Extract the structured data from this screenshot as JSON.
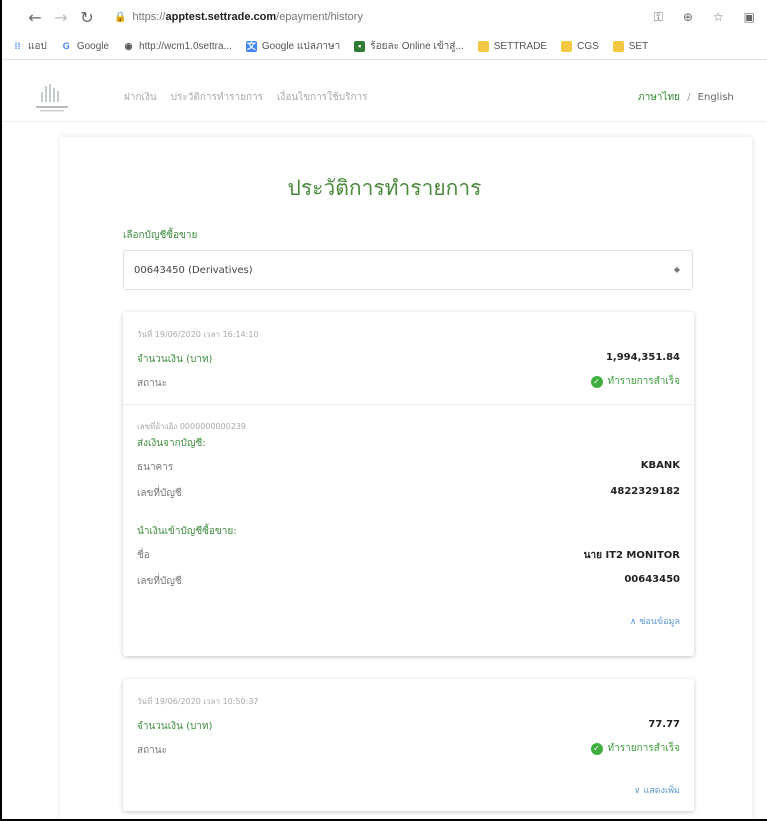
{
  "browser": {
    "url_prefix": "https://",
    "url_host": "apptest.settrade.com",
    "url_path": "/epayment/history",
    "bookmarks": [
      {
        "label": "แอป",
        "icon": "apps-grid-icon",
        "color": "#4a8af4"
      },
      {
        "label": "Google",
        "icon": "google-icon",
        "color": "#4285f4"
      },
      {
        "label": "http://wcm1.0settra...",
        "icon": "globe-icon",
        "color": "#555555"
      },
      {
        "label": "Google แปลภาษา",
        "icon": "translate-icon",
        "color": "#4285f4"
      },
      {
        "label": "ร้อยละ Online เข้าสู่...",
        "icon": "app-icon",
        "color": "#2e7d32"
      },
      {
        "label": "SETTRADE",
        "icon": "folder-icon",
        "color": "#f4c842"
      },
      {
        "label": "CGS",
        "icon": "folder-icon",
        "color": "#f4c842"
      },
      {
        "label": "SET",
        "icon": "folder-icon",
        "color": "#f4c842"
      }
    ]
  },
  "site": {
    "nav": [
      "ฝากเงิน",
      "ประวัติการทำรายการ",
      "เงื่อนไขการใช้บริการ"
    ],
    "lang_active": "ภาษาไทย",
    "lang_sep": "/",
    "lang_other": "English"
  },
  "page": {
    "title": "ประวัติการทำรายการ",
    "account_label": "เลือกบัญชีซื้อขาย",
    "account_value": "00643450 (Derivatives)"
  },
  "transactions": [
    {
      "datetime": "วันที่ 19/06/2020 เวลา 16:14:10",
      "amount_label": "จำนวนเงิน (บาท)",
      "amount": "1,994,351.84",
      "status_label": "สถานะ",
      "status": "ทำรายการสำเร็จ",
      "ref": "เลขที่อ้างอิง 0000000000239",
      "from_heading": "ส่งเงินจากบัญชี:",
      "bank_label": "ธนาคาร",
      "bank": "KBANK",
      "from_acct_label": "เลขที่บัญชี",
      "from_acct": "4822329182",
      "to_heading": "นำเงินเข้าบัญชีซื้อขาย:",
      "name_label": "ชื่อ",
      "name": "นาย IT2 MONITOR",
      "to_acct_label": "เลขที่บัญชี",
      "to_acct": "00643450",
      "toggle": "ซ่อนข้อมูล"
    },
    {
      "datetime": "วันที่ 19/06/2020 เวลา 10:50:37",
      "amount_label": "จำนวนเงิน (บาท)",
      "amount": "77.77",
      "status_label": "สถานะ",
      "status": "ทำรายการสำเร็จ",
      "toggle": "แสดงเพิ่ม"
    }
  ]
}
